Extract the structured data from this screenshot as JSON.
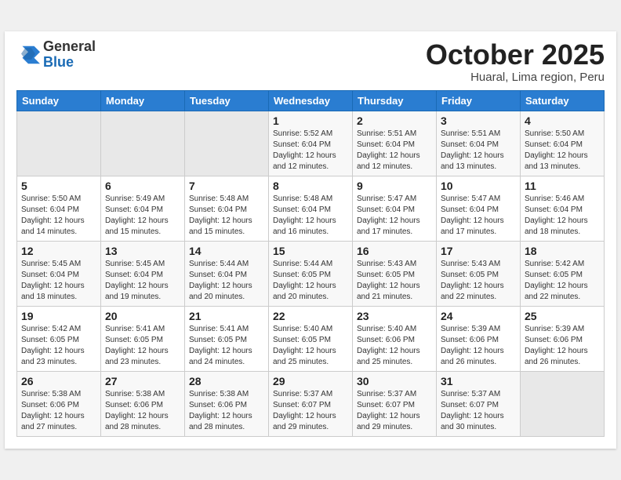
{
  "header": {
    "logo_general": "General",
    "logo_blue": "Blue",
    "month_title": "October 2025",
    "location": "Huaral, Lima region, Peru"
  },
  "weekdays": [
    "Sunday",
    "Monday",
    "Tuesday",
    "Wednesday",
    "Thursday",
    "Friday",
    "Saturday"
  ],
  "weeks": [
    [
      {
        "day": "",
        "empty": true
      },
      {
        "day": "",
        "empty": true
      },
      {
        "day": "",
        "empty": true
      },
      {
        "day": "1",
        "sunrise": "5:52 AM",
        "sunset": "6:04 PM",
        "daylight": "12 hours and 12 minutes."
      },
      {
        "day": "2",
        "sunrise": "5:51 AM",
        "sunset": "6:04 PM",
        "daylight": "12 hours and 12 minutes."
      },
      {
        "day": "3",
        "sunrise": "5:51 AM",
        "sunset": "6:04 PM",
        "daylight": "12 hours and 13 minutes."
      },
      {
        "day": "4",
        "sunrise": "5:50 AM",
        "sunset": "6:04 PM",
        "daylight": "12 hours and 13 minutes."
      }
    ],
    [
      {
        "day": "5",
        "sunrise": "5:50 AM",
        "sunset": "6:04 PM",
        "daylight": "12 hours and 14 minutes."
      },
      {
        "day": "6",
        "sunrise": "5:49 AM",
        "sunset": "6:04 PM",
        "daylight": "12 hours and 15 minutes."
      },
      {
        "day": "7",
        "sunrise": "5:48 AM",
        "sunset": "6:04 PM",
        "daylight": "12 hours and 15 minutes."
      },
      {
        "day": "8",
        "sunrise": "5:48 AM",
        "sunset": "6:04 PM",
        "daylight": "12 hours and 16 minutes."
      },
      {
        "day": "9",
        "sunrise": "5:47 AM",
        "sunset": "6:04 PM",
        "daylight": "12 hours and 17 minutes."
      },
      {
        "day": "10",
        "sunrise": "5:47 AM",
        "sunset": "6:04 PM",
        "daylight": "12 hours and 17 minutes."
      },
      {
        "day": "11",
        "sunrise": "5:46 AM",
        "sunset": "6:04 PM",
        "daylight": "12 hours and 18 minutes."
      }
    ],
    [
      {
        "day": "12",
        "sunrise": "5:45 AM",
        "sunset": "6:04 PM",
        "daylight": "12 hours and 18 minutes."
      },
      {
        "day": "13",
        "sunrise": "5:45 AM",
        "sunset": "6:04 PM",
        "daylight": "12 hours and 19 minutes."
      },
      {
        "day": "14",
        "sunrise": "5:44 AM",
        "sunset": "6:04 PM",
        "daylight": "12 hours and 20 minutes."
      },
      {
        "day": "15",
        "sunrise": "5:44 AM",
        "sunset": "6:05 PM",
        "daylight": "12 hours and 20 minutes."
      },
      {
        "day": "16",
        "sunrise": "5:43 AM",
        "sunset": "6:05 PM",
        "daylight": "12 hours and 21 minutes."
      },
      {
        "day": "17",
        "sunrise": "5:43 AM",
        "sunset": "6:05 PM",
        "daylight": "12 hours and 22 minutes."
      },
      {
        "day": "18",
        "sunrise": "5:42 AM",
        "sunset": "6:05 PM",
        "daylight": "12 hours and 22 minutes."
      }
    ],
    [
      {
        "day": "19",
        "sunrise": "5:42 AM",
        "sunset": "6:05 PM",
        "daylight": "12 hours and 23 minutes."
      },
      {
        "day": "20",
        "sunrise": "5:41 AM",
        "sunset": "6:05 PM",
        "daylight": "12 hours and 23 minutes."
      },
      {
        "day": "21",
        "sunrise": "5:41 AM",
        "sunset": "6:05 PM",
        "daylight": "12 hours and 24 minutes."
      },
      {
        "day": "22",
        "sunrise": "5:40 AM",
        "sunset": "6:05 PM",
        "daylight": "12 hours and 25 minutes."
      },
      {
        "day": "23",
        "sunrise": "5:40 AM",
        "sunset": "6:06 PM",
        "daylight": "12 hours and 25 minutes."
      },
      {
        "day": "24",
        "sunrise": "5:39 AM",
        "sunset": "6:06 PM",
        "daylight": "12 hours and 26 minutes."
      },
      {
        "day": "25",
        "sunrise": "5:39 AM",
        "sunset": "6:06 PM",
        "daylight": "12 hours and 26 minutes."
      }
    ],
    [
      {
        "day": "26",
        "sunrise": "5:38 AM",
        "sunset": "6:06 PM",
        "daylight": "12 hours and 27 minutes."
      },
      {
        "day": "27",
        "sunrise": "5:38 AM",
        "sunset": "6:06 PM",
        "daylight": "12 hours and 28 minutes."
      },
      {
        "day": "28",
        "sunrise": "5:38 AM",
        "sunset": "6:06 PM",
        "daylight": "12 hours and 28 minutes."
      },
      {
        "day": "29",
        "sunrise": "5:37 AM",
        "sunset": "6:07 PM",
        "daylight": "12 hours and 29 minutes."
      },
      {
        "day": "30",
        "sunrise": "5:37 AM",
        "sunset": "6:07 PM",
        "daylight": "12 hours and 29 minutes."
      },
      {
        "day": "31",
        "sunrise": "5:37 AM",
        "sunset": "6:07 PM",
        "daylight": "12 hours and 30 minutes."
      },
      {
        "day": "",
        "empty": true
      }
    ]
  ],
  "labels": {
    "sunrise": "Sunrise:",
    "sunset": "Sunset:",
    "daylight": "Daylight:"
  }
}
